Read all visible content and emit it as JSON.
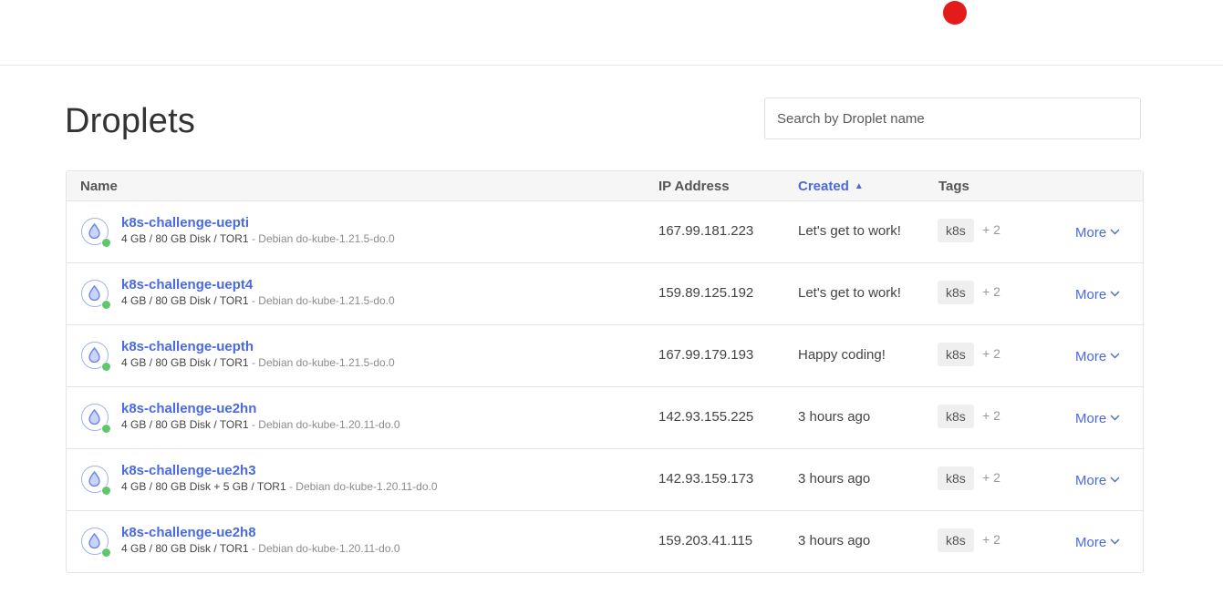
{
  "page": {
    "title": "Droplets",
    "search_placeholder": "Search by Droplet name"
  },
  "table": {
    "columns": {
      "name": "Name",
      "ip": "IP Address",
      "created": "Created",
      "tags": "Tags"
    },
    "sort_indicator": "▲",
    "rows": [
      {
        "name": "k8s-challenge-uepti",
        "specs": "4 GB / 80 GB Disk / TOR1",
        "image": " - Debian do-kube-1.21.5-do.0",
        "ip": "167.99.181.223",
        "created": "Let's get to work!",
        "tag": "k8s",
        "tag_more": "+ 2",
        "more": "More"
      },
      {
        "name": "k8s-challenge-uept4",
        "specs": "4 GB / 80 GB Disk / TOR1",
        "image": " - Debian do-kube-1.21.5-do.0",
        "ip": "159.89.125.192",
        "created": "Let's get to work!",
        "tag": "k8s",
        "tag_more": "+ 2",
        "more": "More"
      },
      {
        "name": "k8s-challenge-uepth",
        "specs": "4 GB / 80 GB Disk / TOR1",
        "image": " - Debian do-kube-1.21.5-do.0",
        "ip": "167.99.179.193",
        "created": "Happy coding!",
        "tag": "k8s",
        "tag_more": "+ 2",
        "more": "More"
      },
      {
        "name": "k8s-challenge-ue2hn",
        "specs": "4 GB / 80 GB Disk / TOR1",
        "image": " - Debian do-kube-1.20.11-do.0",
        "ip": "142.93.155.225",
        "created": "3 hours ago",
        "tag": "k8s",
        "tag_more": "+ 2",
        "more": "More"
      },
      {
        "name": "k8s-challenge-ue2h3",
        "specs": "4 GB / 80 GB Disk + 5 GB / TOR1",
        "image": " - Debian do-kube-1.20.11-do.0",
        "ip": "142.93.159.173",
        "created": "3 hours ago",
        "tag": "k8s",
        "tag_more": "+ 2",
        "more": "More"
      },
      {
        "name": "k8s-challenge-ue2h8",
        "specs": "4 GB / 80 GB Disk / TOR1",
        "image": " - Debian do-kube-1.20.11-do.0",
        "ip": "159.203.41.115",
        "created": "3 hours ago",
        "tag": "k8s",
        "tag_more": "+ 2",
        "more": "More"
      }
    ]
  },
  "icons": {
    "droplet": "droplet-icon",
    "status": "status-online-indicator",
    "more_chevron": "chevron-down-icon",
    "recording": "red-dot-indicator"
  },
  "colors": {
    "accent": "#4a69e2",
    "status_online": "#5fc66a",
    "recording_dot": "#e31b1b"
  }
}
